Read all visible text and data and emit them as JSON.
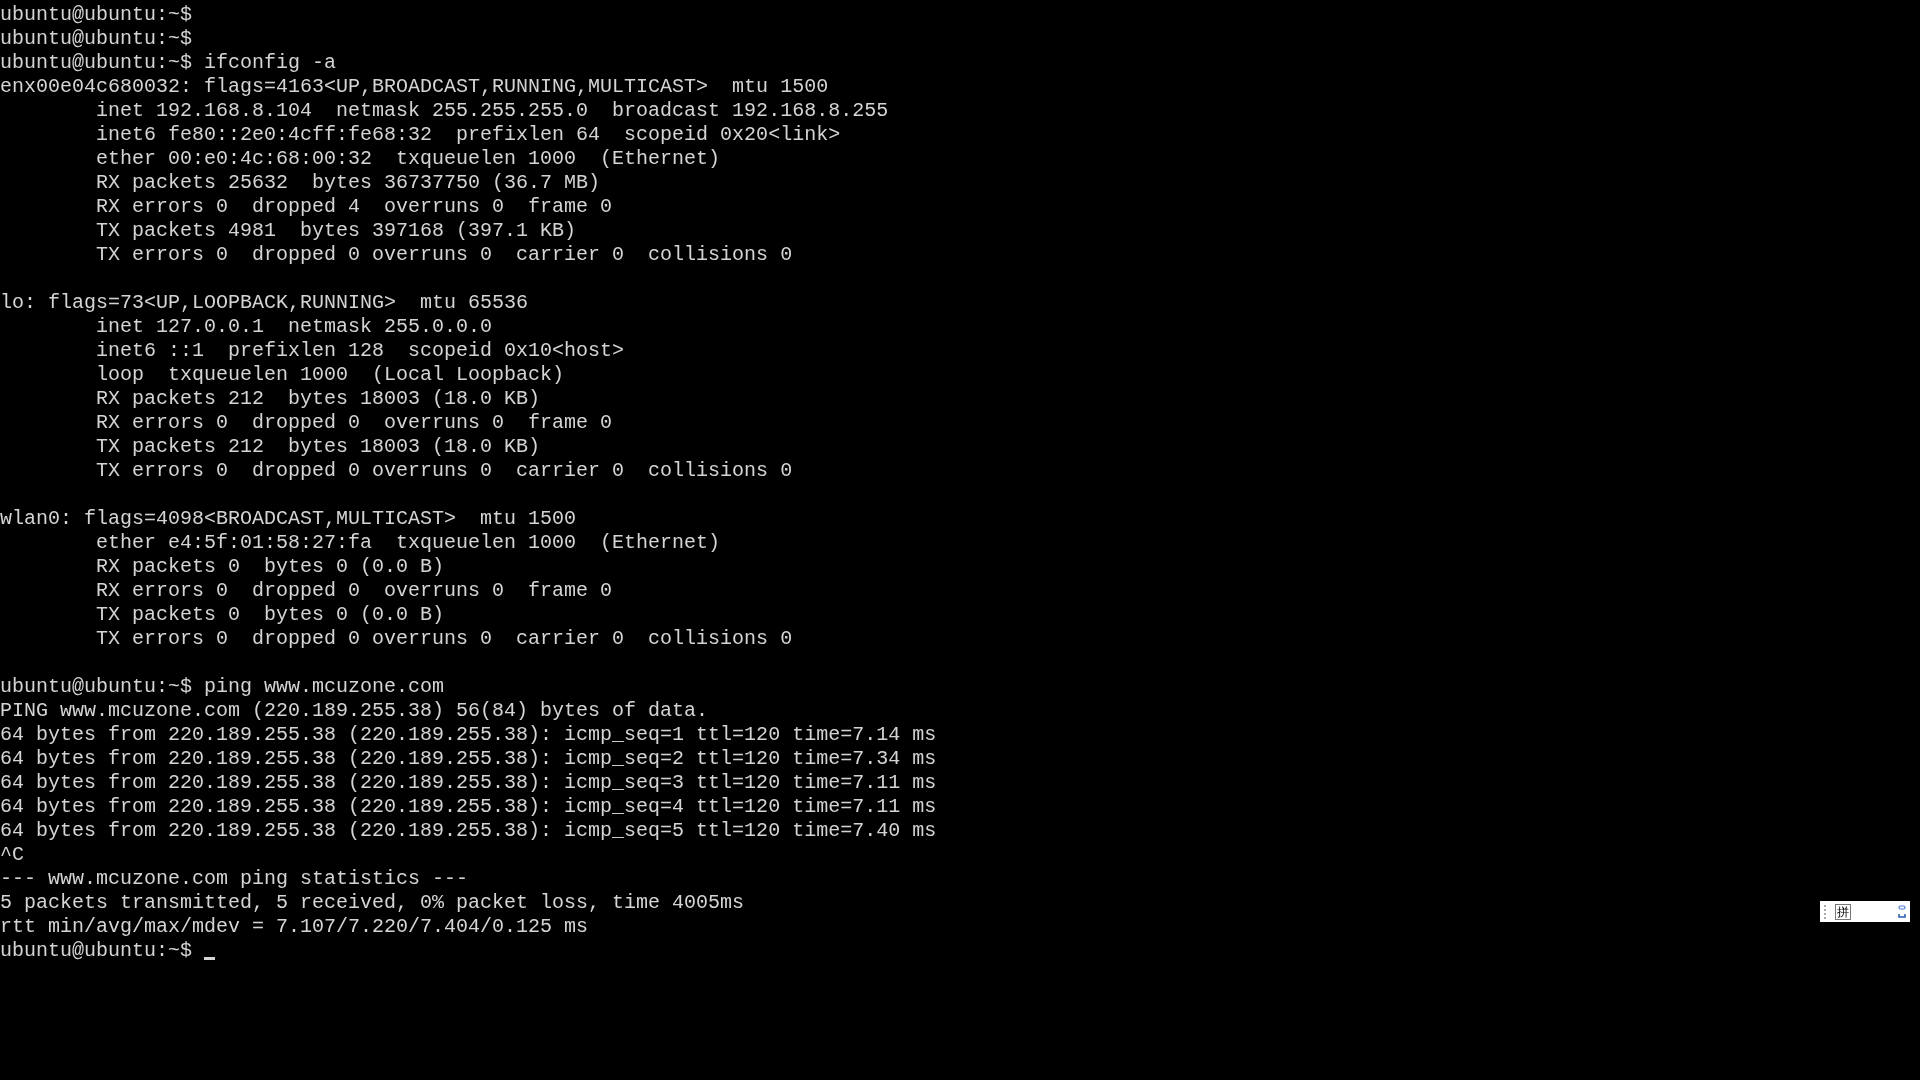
{
  "terminal": {
    "blocks": [
      {
        "lines": [
          "ubuntu@ubuntu:~$",
          "ubuntu@ubuntu:~$",
          "ubuntu@ubuntu:~$ ifconfig -a",
          "enx00e04c680032: flags=4163<UP,BROADCAST,RUNNING,MULTICAST>  mtu 1500",
          "        inet 192.168.8.104  netmask 255.255.255.0  broadcast 192.168.8.255",
          "        inet6 fe80::2e0:4cff:fe68:32  prefixlen 64  scopeid 0x20<link>",
          "        ether 00:e0:4c:68:00:32  txqueuelen 1000  (Ethernet)",
          "        RX packets 25632  bytes 36737750 (36.7 MB)",
          "        RX errors 0  dropped 4  overruns 0  frame 0",
          "        TX packets 4981  bytes 397168 (397.1 KB)",
          "        TX errors 0  dropped 0 overruns 0  carrier 0  collisions 0"
        ]
      },
      {
        "lines": [
          "lo: flags=73<UP,LOOPBACK,RUNNING>  mtu 65536",
          "        inet 127.0.0.1  netmask 255.0.0.0",
          "        inet6 ::1  prefixlen 128  scopeid 0x10<host>",
          "        loop  txqueuelen 1000  (Local Loopback)",
          "        RX packets 212  bytes 18003 (18.0 KB)",
          "        RX errors 0  dropped 0  overruns 0  frame 0",
          "        TX packets 212  bytes 18003 (18.0 KB)",
          "        TX errors 0  dropped 0 overruns 0  carrier 0  collisions 0"
        ]
      },
      {
        "lines": [
          "wlan0: flags=4098<BROADCAST,MULTICAST>  mtu 1500",
          "        ether e4:5f:01:58:27:fa  txqueuelen 1000  (Ethernet)",
          "        RX packets 0  bytes 0 (0.0 B)",
          "        RX errors 0  dropped 0  overruns 0  frame 0",
          "        TX packets 0  bytes 0 (0.0 B)",
          "        TX errors 0  dropped 0 overruns 0  carrier 0  collisions 0"
        ]
      },
      {
        "lines": [
          "ubuntu@ubuntu:~$ ping www.mcuzone.com",
          "PING www.mcuzone.com (220.189.255.38) 56(84) bytes of data.",
          "64 bytes from 220.189.255.38 (220.189.255.38): icmp_seq=1 ttl=120 time=7.14 ms",
          "64 bytes from 220.189.255.38 (220.189.255.38): icmp_seq=2 ttl=120 time=7.34 ms",
          "64 bytes from 220.189.255.38 (220.189.255.38): icmp_seq=3 ttl=120 time=7.11 ms",
          "64 bytes from 220.189.255.38 (220.189.255.38): icmp_seq=4 ttl=120 time=7.11 ms",
          "64 bytes from 220.189.255.38 (220.189.255.38): icmp_seq=5 ttl=120 time=7.40 ms",
          "^C",
          "--- www.mcuzone.com ping statistics ---",
          "5 packets transmitted, 5 received, 0% packet loss, time 4005ms",
          "rtt min/avg/max/mdev = 7.107/7.220/7.404/0.125 ms"
        ]
      }
    ],
    "prompt": "ubuntu@ubuntu:~$"
  },
  "ime_toolbar": {
    "mode": "拼"
  }
}
